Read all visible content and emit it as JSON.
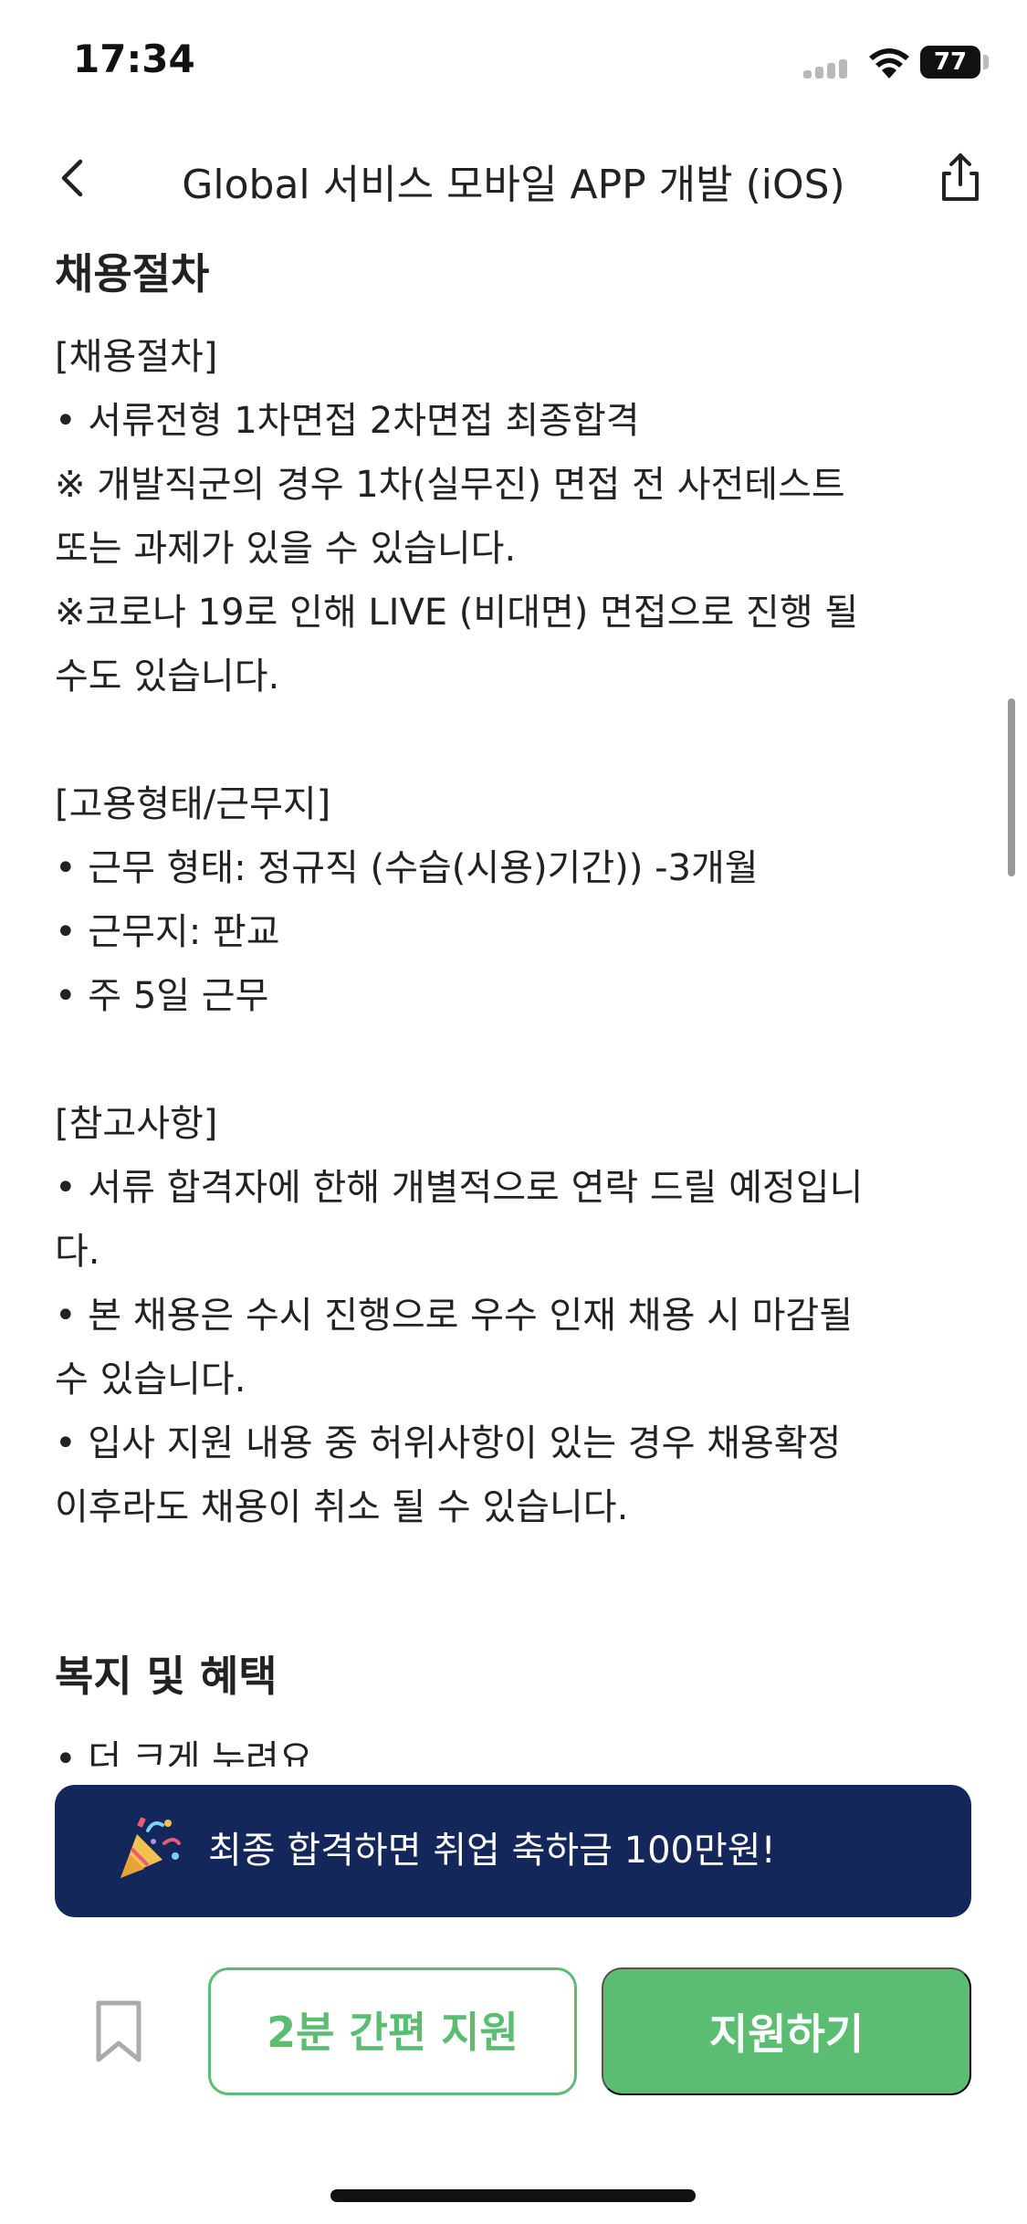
{
  "status_bar": {
    "time": "17:34",
    "battery": "77"
  },
  "nav": {
    "title": "Global 서비스 모바일 APP 개발 (iOS)",
    "back_icon": "chevron-left-icon",
    "share_icon": "share-icon"
  },
  "sections": {
    "process_title": "채용절차",
    "process_lines": [
      "[채용절차]",
      "•  서류전형  1차면접  2차면접  최종합격",
      "※ 개발직군의 경우 1차(실무진) 면접 전 사전테스트",
      "또는 과제가 있을 수 있습니다.",
      "※코로나 19로 인해 LIVE (비대면) 면접으로 진행 될",
      "수도 있습니다."
    ],
    "employment_lines": [
      "[고용형태/근무지]",
      "•  근무 형태: 정규직 (수습(시용)기간)) -3개월",
      "•  근무지: 판교",
      "•  주 5일 근무"
    ],
    "notes_lines": [
      "[참고사항]",
      "•  서류 합격자에 한해 개별적으로 연락 드릴 예정입니",
      "다.",
      "•  본 채용은 수시 진행으로 우수 인재 채용 시 마감될",
      "수 있습니다.",
      "•  입사 지원 내용 중 허위사항이 있는 경우 채용확정",
      "이후라도 채용이 취소 될 수 있습니다."
    ],
    "benefits_title": "복지 및 혜택",
    "benefits_lines": [
      "•  더 크게 누려요"
    ]
  },
  "promo": {
    "text": "최종 합격하면  취업 축하금 100만원!",
    "icon": "party-popper-icon"
  },
  "actions": {
    "bookmark_icon": "bookmark-icon",
    "quick_apply_label": "2분 간편 지원",
    "apply_label": "지원하기"
  },
  "colors": {
    "accent_green": "#5abd71",
    "banner_navy": "#14275b"
  }
}
